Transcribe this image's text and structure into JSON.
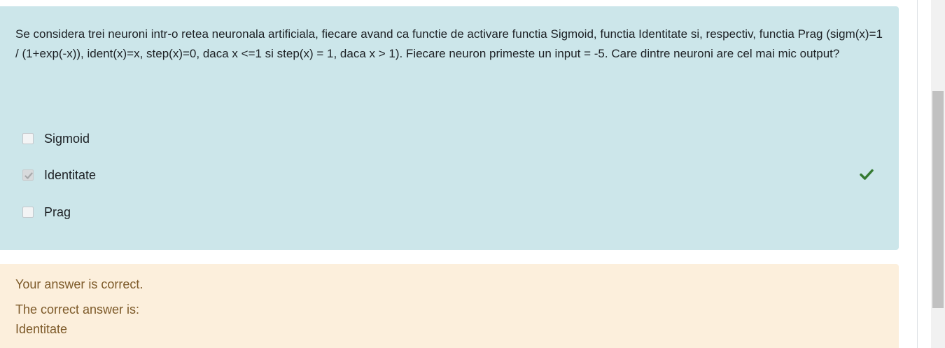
{
  "question": {
    "text": "Se considera trei neuroni intr-o retea neuronala artificiala, fiecare avand ca functie de activare functia Sigmoid, functia Identitate si, respectiv, functia Prag (sigm(x)=1 / (1+exp(-x)), ident(x)=x, step(x)=0, daca x <=1 si step(x) = 1, daca x > 1). Fiecare neuron primeste un input = -5. Care dintre neuroni are cel mai mic output?",
    "options": [
      {
        "label": "Sigmoid",
        "checked": false
      },
      {
        "label": "Identitate",
        "checked": true,
        "correct_icon": "checkmark-icon"
      },
      {
        "label": "Prag",
        "checked": false
      }
    ]
  },
  "feedback": {
    "status": "Your answer is correct.",
    "correct_answer_label": "The correct answer is:",
    "correct_answer": "Identitate"
  },
  "colors": {
    "question_bg": "#cce6ea",
    "feedback_bg": "#fcefdc",
    "feedback_text": "#7d5a29",
    "correct_green": "#357a32"
  }
}
